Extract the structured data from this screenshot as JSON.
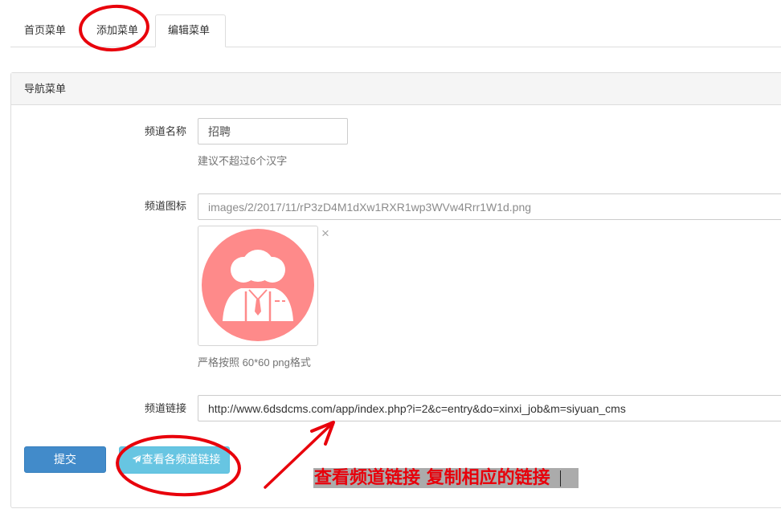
{
  "tabs": [
    {
      "label": "首页菜单"
    },
    {
      "label": "添加菜单"
    },
    {
      "label": "编辑菜单",
      "active": true
    }
  ],
  "panel": {
    "heading": "导航菜单"
  },
  "form": {
    "name": {
      "label": "频道名称",
      "value": "招聘",
      "help": "建议不超过6个汉字"
    },
    "icon": {
      "label": "频道图标",
      "value": "images/2/2017/11/rP3zD4M1dXw1RXR1wp3WVw4Rrr1W1d.png",
      "remove": "×",
      "help": "严格按照 60*60 png格式",
      "image_icon": "people-group-icon"
    },
    "link": {
      "label": "频道链接",
      "value": "http://www.6dsdcms.com/app/index.php?i=2&c=entry&do=xinxi_job&m=siyuan_cms"
    }
  },
  "buttons": {
    "submit": "提交",
    "view_links": "查看各频道链接",
    "view_links_icon": "paper-plane-icon"
  },
  "annotation": {
    "text": "查看频道链接 复制相应的链接"
  },
  "colors": {
    "primary": "#428bca",
    "info": "#5bc0de",
    "annotation_red": "#e8000b",
    "icon_pink": "#fe8a8a",
    "highlight_gray": "#ababab"
  }
}
